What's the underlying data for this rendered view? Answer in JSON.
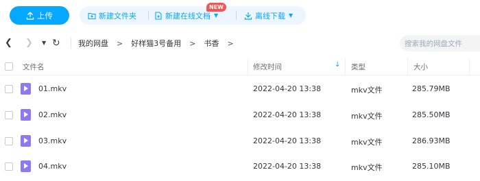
{
  "toolbar": {
    "upload_label": "上传",
    "new_folder_label": "新建文件夹",
    "new_online_doc_label": "新建在线文档",
    "new_badge": "NEW",
    "offline_download_label": "离线下载"
  },
  "nav": {
    "breadcrumbs": [
      "我的网盘",
      "好样猫3号备用",
      "书香"
    ],
    "search_placeholder": "搜索我的网盘文件"
  },
  "table": {
    "headers": {
      "name": "文件名",
      "modified": "修改时间",
      "type": "类型",
      "size": "大小"
    },
    "rows": [
      {
        "name": "01.mkv",
        "modified": "2022-04-20 13:38",
        "type": "mkv文件",
        "size": "285.79MB"
      },
      {
        "name": "02.mkv",
        "modified": "2022-04-20 13:38",
        "type": "mkv文件",
        "size": "285.50MB"
      },
      {
        "name": "03.mkv",
        "modified": "2022-04-20 13:38",
        "type": "mkv文件",
        "size": "286.93MB"
      },
      {
        "name": "04.mkv",
        "modified": "2022-04-20 13:38",
        "type": "mkv文件",
        "size": "285.10MB"
      }
    ]
  },
  "colors": {
    "accent": "#06a7ff",
    "video_icon": "#8e79f1",
    "badge": "#f55454"
  }
}
